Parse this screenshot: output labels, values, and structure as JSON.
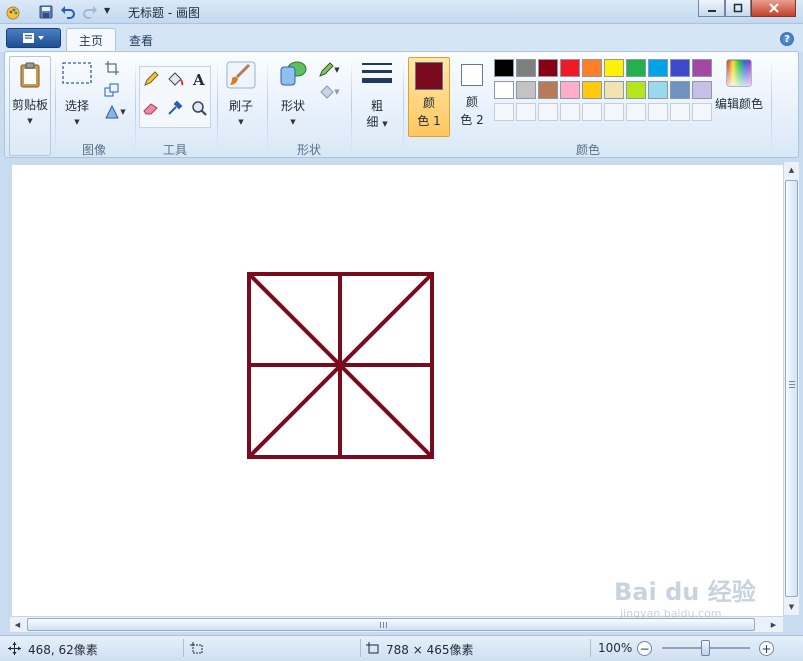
{
  "window": {
    "title": "无标题 - 画图"
  },
  "tabs": [
    {
      "label": "主页",
      "active": true
    },
    {
      "label": "查看",
      "active": false
    }
  ],
  "ribbon": {
    "clipboard": {
      "label": "剪贴板"
    },
    "image": {
      "select_label": "选择",
      "group_label": "图像"
    },
    "tools": {
      "group_label": "工具"
    },
    "brushes": {
      "label": "刷子"
    },
    "shapes": {
      "label": "形状",
      "group_label": "形状"
    },
    "size": {
      "label_line1": "粗",
      "label_line2": "细"
    },
    "colors": {
      "color1_line1": "颜",
      "color1_line2": "色 1",
      "color2_line1": "颜",
      "color2_line2": "色 2",
      "edit_label": "编辑颜色",
      "group_label": "颜色",
      "color1_value": "#7a0a1e",
      "color2_value": "#ffffff",
      "palette_row1": [
        "#000000",
        "#7f7f7f",
        "#880015",
        "#ed1c24",
        "#ff7f27",
        "#fff200",
        "#22b14c",
        "#00a2e8",
        "#3f48cc",
        "#a349a4"
      ],
      "palette_row2": [
        "#ffffff",
        "#c3c3c3",
        "#b97a57",
        "#ffaec9",
        "#ffc90e",
        "#efe4b0",
        "#b5e61d",
        "#99d9ea",
        "#7092be",
        "#c8bfe7"
      ]
    }
  },
  "drawing": {
    "stroke_color": "#7a0a1e"
  },
  "status": {
    "cursor_position": "468, 62像素",
    "canvas_size": "788 × 465像素",
    "zoom": "100%"
  },
  "watermark": {
    "text": "Bai du 经验",
    "subtext": "jingyan.baidu.com"
  }
}
